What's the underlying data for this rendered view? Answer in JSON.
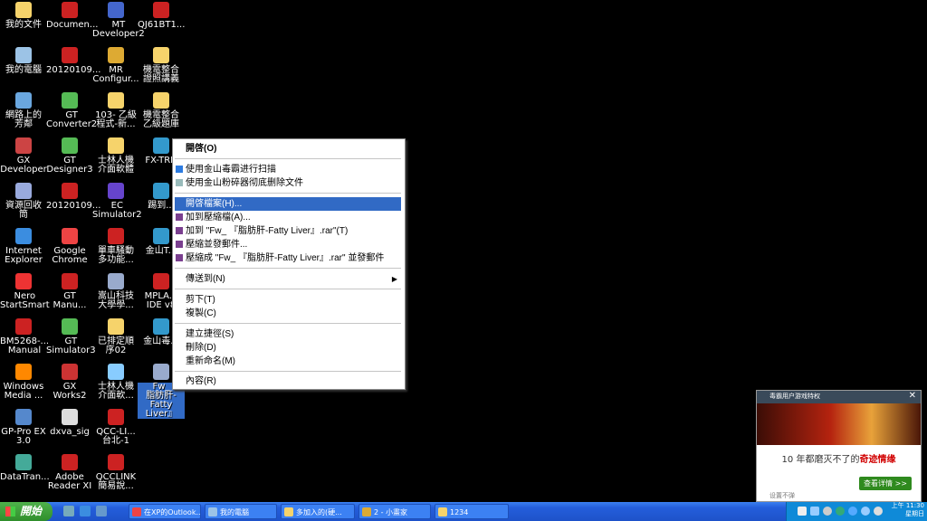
{
  "desktop": {
    "icons": [
      {
        "label": "我的文件",
        "color": "#f6d36b"
      },
      {
        "label": "我的電腦",
        "color": "#9cc3e6"
      },
      {
        "label": "網路上的\n芳鄰",
        "color": "#6aa7df"
      },
      {
        "label": "GX\nDeveloper",
        "color": "#c44"
      },
      {
        "label": "資源回收\n筒",
        "color": "#9ad"
      },
      {
        "label": "Internet\nExplorer",
        "color": "#3b8de0"
      },
      {
        "label": "Nero\nStartSmart",
        "color": "#e33"
      },
      {
        "label": "BM5268-...\nManual",
        "color": "#c22"
      },
      {
        "label": "Windows\nMedia ...",
        "color": "#f80"
      },
      {
        "label": "GP-Pro EX\n3.0",
        "color": "#58c"
      },
      {
        "label": "DataTran...",
        "color": "#4a9"
      },
      {
        "label": "Documen...",
        "color": "#c22"
      },
      {
        "label": "20120109...",
        "color": "#c22"
      },
      {
        "label": "GT\nConverter2",
        "color": "#5b5"
      },
      {
        "label": "GT\nDesigner3",
        "color": "#5b5"
      },
      {
        "label": "20120109...",
        "color": "#c22"
      },
      {
        "label": "Google\nChrome",
        "color": "#e44"
      },
      {
        "label": "GT\nManu...",
        "color": "#c22"
      },
      {
        "label": "GT\nSimulator3",
        "color": "#5b5"
      },
      {
        "label": "GX Works2",
        "color": "#c33"
      },
      {
        "label": "dxva_sig",
        "color": "#ddd"
      },
      {
        "label": "Adobe\nReader XI",
        "color": "#c22"
      },
      {
        "label": "MT\nDeveloper2",
        "color": "#46c"
      },
      {
        "label": "MR\nConfigur...",
        "color": "#da3"
      },
      {
        "label": "103- 乙級\n程式-新...",
        "color": "#f6d36b"
      },
      {
        "label": "士林人機\n介面軟體",
        "color": "#f6d36b"
      },
      {
        "label": "EC\nSimulator2",
        "color": "#64c"
      },
      {
        "label": "單車騷動\n多功能...",
        "color": "#c22"
      },
      {
        "label": "嵩山科技\n大學學...",
        "color": "#9ac"
      },
      {
        "label": "已排定順\n序02",
        "color": "#f6d36b"
      },
      {
        "label": "士林人機\n介面軟...",
        "color": "#8cf"
      },
      {
        "label": "QCC-LI...\n台北-1",
        "color": "#c22"
      },
      {
        "label": "QCCLINK\n簡易說...",
        "color": "#c22"
      },
      {
        "label": "QJ61BT1...",
        "color": "#c22"
      },
      {
        "label": "機電整合\n證照講義",
        "color": "#f6d36b"
      },
      {
        "label": "機電整合\n乙級題庫",
        "color": "#f6d36b"
      },
      {
        "label": "FX-TRN",
        "color": "#39c"
      },
      {
        "label": "踢到...",
        "color": "#39c"
      },
      {
        "label": "金山T...",
        "color": "#39c"
      },
      {
        "label": "MPLA...\nIDE v8",
        "color": "#c22"
      },
      {
        "label": "金山毒...",
        "color": "#39c"
      },
      {
        "label": "Fw_\n脂肪肝-Fatty\nLiver』",
        "color": "#9ac"
      }
    ]
  },
  "context_menu": {
    "items": [
      {
        "label": "開啓(O)",
        "bold": true
      },
      {
        "label": "使用金山毒霸进行扫描",
        "icon": true
      },
      {
        "label": "使用金山粉碎器彻底删除文件",
        "icon": true
      },
      {
        "label": "開啓檔案(H)...",
        "highlight": true
      },
      {
        "label": "加到壓縮檔(A)...",
        "icon": true
      },
      {
        "label": "加到 \"Fw_ 『脂肪肝-Fatty Liver』.rar\"(T)",
        "icon": true
      },
      {
        "label": "壓縮並發郵件...",
        "icon": true
      },
      {
        "label": "壓縮成 \"Fw_ 『脂肪肝-Fatty Liver』.rar\" 並發郵件",
        "icon": true
      },
      {
        "label": "傳送到(N)",
        "submenu": true
      },
      {
        "label": "剪下(T)"
      },
      {
        "label": "複製(C)"
      },
      {
        "label": "建立捷徑(S)"
      },
      {
        "label": "刪除(D)"
      },
      {
        "label": "重新命名(M)"
      },
      {
        "label": "內容(R)"
      }
    ]
  },
  "popup": {
    "title": "毒霸用户游戏特权",
    "close": "✕",
    "message_prefix": "10 年都磨灭不了的",
    "message_highlight": "奇迹情缘",
    "button": "查看详情 >>",
    "footer": "设置不弹"
  },
  "taskbar": {
    "start_label": "開始",
    "buttons": [
      {
        "label": "在XP的Outlook...",
        "color": "#e44"
      },
      {
        "label": "我的電腦",
        "color": "#9cc3e6"
      },
      {
        "label": "多加入的(硬...",
        "color": "#f6d36b"
      },
      {
        "label": "2 - 小畫家",
        "color": "#da3"
      },
      {
        "label": "1234",
        "color": "#f6d36b"
      }
    ],
    "clock_time": "上午 11:30",
    "clock_day": "星期日"
  },
  "colors": {
    "selection": "#316ac5",
    "taskbar": "#245edb",
    "start": "#2f8e2b"
  }
}
